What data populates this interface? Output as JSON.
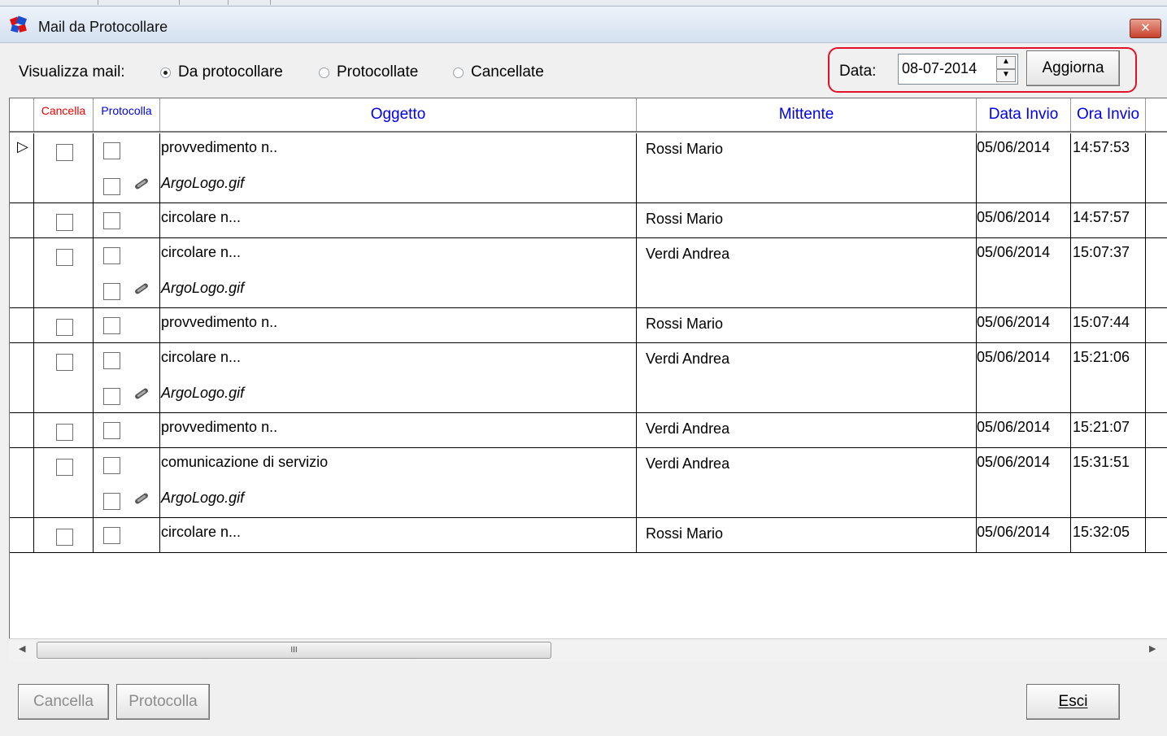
{
  "window": {
    "title": "Mail da Protocollare",
    "close_label": "✕"
  },
  "filter": {
    "label": "Visualizza mail:",
    "options": [
      {
        "label": "Da protocollare",
        "selected": true
      },
      {
        "label": "Protocollate",
        "selected": false
      },
      {
        "label": "Cancellate",
        "selected": false
      }
    ]
  },
  "date_control": {
    "label": "Data:",
    "value": "08-07-2014",
    "refresh_label": "Aggiorna"
  },
  "table": {
    "columns": {
      "cancella": "Cancella",
      "protocolla": "Protocolla",
      "oggetto": "Oggetto",
      "mittente": "Mittente",
      "data_invio": "Data Invio",
      "ora_invio": "Ora Invio"
    },
    "rows": [
      {
        "oggetto": "provvedimento n..",
        "mittente": "Rossi Mario",
        "data": "05/06/2014",
        "ora": "14:57:53",
        "attachment": "ArgoLogo.gif"
      },
      {
        "oggetto": "circolare n...",
        "mittente": "Rossi Mario",
        "data": "05/06/2014",
        "ora": "14:57:57",
        "attachment": null
      },
      {
        "oggetto": "circolare n...",
        "mittente": "Verdi Andrea",
        "data": "05/06/2014",
        "ora": "15:07:37",
        "attachment": "ArgoLogo.gif"
      },
      {
        "oggetto": "provvedimento n..",
        "mittente": "Rossi Mario",
        "data": "05/06/2014",
        "ora": "15:07:44",
        "attachment": null
      },
      {
        "oggetto": "circolare n...",
        "mittente": "Verdi Andrea",
        "data": "05/06/2014",
        "ora": "15:21:06",
        "attachment": "ArgoLogo.gif"
      },
      {
        "oggetto": "provvedimento n..",
        "mittente": "Verdi Andrea",
        "data": "05/06/2014",
        "ora": "15:21:07",
        "attachment": null
      },
      {
        "oggetto": "comunicazione di servizio",
        "mittente": "Verdi Andrea",
        "data": "05/06/2014",
        "ora": "15:31:51",
        "attachment": "ArgoLogo.gif"
      },
      {
        "oggetto": "circolare n...",
        "mittente": "Rossi Mario",
        "data": "05/06/2014",
        "ora": "15:32:05",
        "attachment": null
      }
    ]
  },
  "scrollbar": {
    "grip_label": "III"
  },
  "footer": {
    "cancella_label": "Cancella",
    "protocolla_label": "Protocolla",
    "esci_label": "Esci"
  },
  "colors": {
    "highlight_border": "#e3102a",
    "header_blue": "#0000ee",
    "header_red": "#ee0000"
  }
}
